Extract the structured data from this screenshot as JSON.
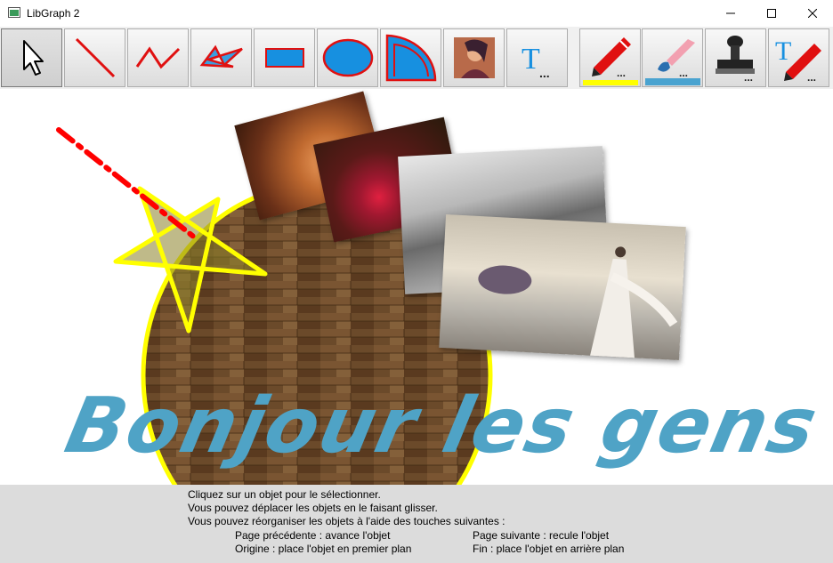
{
  "window": {
    "title": "LibGraph 2",
    "controls": [
      "minimize",
      "maximize",
      "close"
    ]
  },
  "toolbar": {
    "tools": [
      {
        "name": "select",
        "icon": "arrow-cursor-icon",
        "active": true
      },
      {
        "name": "line",
        "icon": "line-icon"
      },
      {
        "name": "polyline",
        "icon": "polyline-icon"
      },
      {
        "name": "polygon",
        "icon": "polygon-icon"
      },
      {
        "name": "rectangle",
        "icon": "rectangle-icon"
      },
      {
        "name": "ellipse",
        "icon": "ellipse-icon"
      },
      {
        "name": "pie",
        "icon": "pie-icon"
      },
      {
        "name": "image",
        "icon": "image-icon"
      },
      {
        "name": "text",
        "icon": "text-icon",
        "glyph": "T"
      },
      {
        "name": "pen-color",
        "icon": "pen-icon",
        "swatch": "#ffff00"
      },
      {
        "name": "brush-color",
        "icon": "brush-icon",
        "swatch": "#4aa3d0"
      },
      {
        "name": "stamp",
        "icon": "stamp-icon"
      },
      {
        "name": "text-color",
        "icon": "text-pen-icon",
        "glyph": "T"
      }
    ]
  },
  "canvas": {
    "headline": "Bonjour les gens !",
    "colors": {
      "headline": "#4fa3c6",
      "star": "#ffff00",
      "dashed_line": "#ff0000",
      "circle_border": "#ffff00",
      "circle_fill": "#6b4a2a"
    }
  },
  "help": {
    "line1": "Cliquez sur un objet pour le sélectionner.",
    "line2": "Vous pouvez déplacer les objets en le faisant glisser.",
    "line3": "Vous pouvez réorganiser les objets à l'aide des touches suivantes :",
    "key1": "Page  précédente  :  avance  l'objet",
    "key2": "Page suivante : recule l'objet",
    "key3": "Origine  :  place  l'objet  en  premier plan",
    "key4": "Fin : place l'objet en arrière plan"
  }
}
